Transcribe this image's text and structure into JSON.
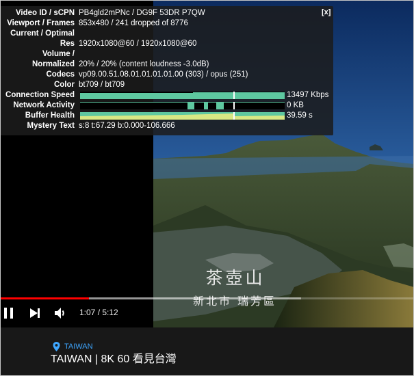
{
  "stats": {
    "close_label": "[x]",
    "rows": [
      {
        "label": "Video ID / sCPN",
        "value": "PB4gld2mPNc / DG9F 53DR P7QW"
      },
      {
        "label": "Viewport / Frames",
        "value": "853x480 / 241 dropped of 8776"
      },
      {
        "label": "Current / Optimal",
        "value": ""
      },
      {
        "label": "Res",
        "value": "1920x1080@60 / 1920x1080@60"
      },
      {
        "label": "Volume /",
        "value": ""
      },
      {
        "label": "Normalized",
        "value": "20% / 20% (content loudness -3.0dB)"
      },
      {
        "label": "Codecs",
        "value": "vp09.00.51.08.01.01.01.01.00 (303) / opus (251)"
      },
      {
        "label": "Color",
        "value": "bt709 / bt709"
      },
      {
        "label": "Connection Speed",
        "value": "13497 Kbps"
      },
      {
        "label": "Network Activity",
        "value": "0 KB"
      },
      {
        "label": "Buffer Health",
        "value": "39.59 s"
      },
      {
        "label": "Mystery Text",
        "value": "s:8 t:67.29 b:0.000-106.666"
      }
    ],
    "graph_colors": {
      "speed": "#5ec8a0",
      "network": "#5ec8a0",
      "buffer_top": "#5ec8a0",
      "buffer_bottom": "#d8e884",
      "marker": "#ffffff"
    }
  },
  "overlay": {
    "title_main": "茶壺山",
    "title_sub": "新北市 瑞芳區"
  },
  "controls": {
    "play_pause_icon": "pause-icon",
    "next_icon": "next-icon",
    "volume_icon": "volume-icon",
    "time_text": "1:07 / 5:12",
    "played_fraction": 0.2147,
    "loaded_end_fraction": 0.727,
    "progress_color": "#ff0000"
  },
  "video_info": {
    "location_icon": "location-pin-icon",
    "location": "TAIWAN",
    "title": "TAIWAN | 8K 60 看見台灣",
    "location_color": "#3ea6ff"
  }
}
